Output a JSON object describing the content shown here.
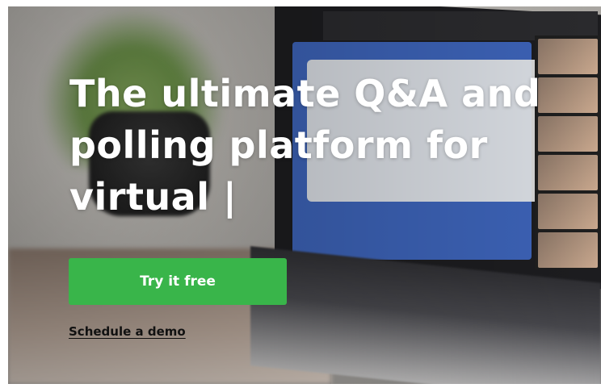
{
  "hero": {
    "headline_line1": "The ultimate Q&A and",
    "headline_line2": "polling platform for",
    "headline_line3": "virtual |",
    "cta_label": "Try it free",
    "demo_link": "Schedule a demo"
  },
  "colors": {
    "cta_green": "#39b54a",
    "headline_text": "#ffffff",
    "link_text": "#111111"
  },
  "background": {
    "description_icon": "laptop-photo"
  }
}
